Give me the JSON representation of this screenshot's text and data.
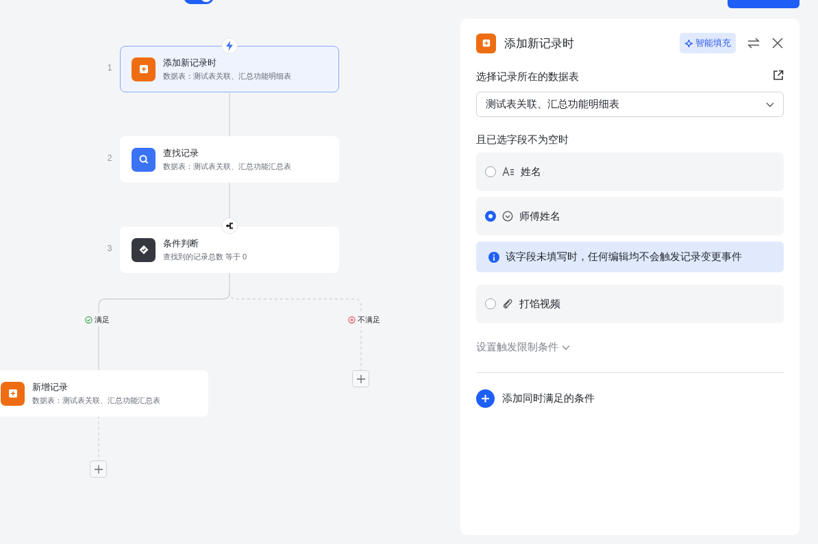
{
  "header": {
    "toggle": {
      "on": true
    }
  },
  "flow": {
    "nodes": [
      {
        "kind": "trigger",
        "index": "1",
        "title": "添加新记录时",
        "subtitle": "数据表：测试表关联、汇总功能明细表",
        "selected": true
      },
      {
        "kind": "find",
        "index": "2",
        "title": "查找记录",
        "subtitle": "数据表：测试表关联、汇总功能汇总表",
        "selected": false
      },
      {
        "kind": "condition",
        "index": "3",
        "title": "条件判断",
        "subtitle": "查找到的记录总数 等于 0",
        "selected": false
      },
      {
        "kind": "add",
        "title": "新增记录",
        "subtitle": "数据表：测试表关联、汇总功能汇总表",
        "selected": false
      }
    ],
    "branches": [
      {
        "kind": "yes",
        "label": "满足"
      },
      {
        "kind": "no",
        "label": "不满足"
      }
    ]
  },
  "panel": {
    "title": "添加新记录时",
    "smart_fill": "智能填充",
    "table_label": "选择记录所在的数据表",
    "table_value": "测试表关联、汇总功能明细表",
    "fields_label": "且已选字段不为空时",
    "options": [
      {
        "kind": "text_field",
        "label": "姓名",
        "selected": false
      },
      {
        "kind": "select_field",
        "label": "师傅姓名",
        "selected": true
      },
      {
        "kind": "note",
        "text": "该字段未填写时，任何编辑均不会触发记录变更事件"
      },
      {
        "kind": "attachment_field",
        "label": "打馅视频",
        "selected": false
      }
    ],
    "limit_label": "设置触发限制条件",
    "add_condition": "添加同时满足的条件"
  }
}
